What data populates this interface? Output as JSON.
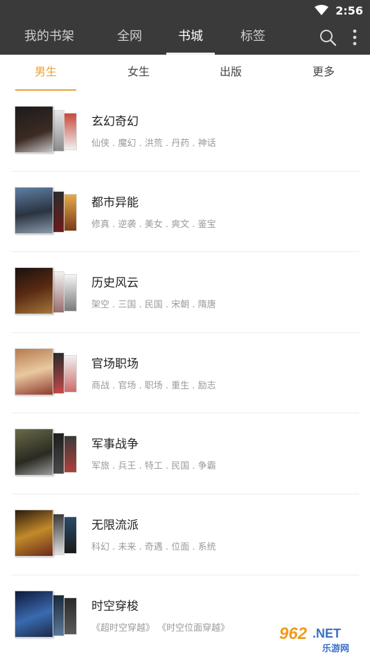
{
  "status_bar": {
    "time": "2:56",
    "wifi_icon": "wifi-icon"
  },
  "top_tabs": [
    {
      "label": "我的书架",
      "active": false
    },
    {
      "label": "全网",
      "active": false
    },
    {
      "label": "书城",
      "active": true
    },
    {
      "label": "标签",
      "active": false
    }
  ],
  "toolbar": {
    "search_icon": "search-icon",
    "more_icon": "more-vertical-icon"
  },
  "sub_tabs": [
    {
      "label": "男生",
      "active": true
    },
    {
      "label": "女生",
      "active": false
    },
    {
      "label": "出版",
      "active": false
    },
    {
      "label": "更多",
      "active": false
    }
  ],
  "categories": [
    {
      "title": "玄幻奇幻",
      "tags": "仙侠 . 魔幻 . 洪荒 . 丹药 . 神话"
    },
    {
      "title": "都市异能",
      "tags": "修真 . 逆袭 . 美女 . 爽文 . 鉴宝"
    },
    {
      "title": "历史风云",
      "tags": "架空 . 三国 . 民国 . 宋朝 . 隋唐"
    },
    {
      "title": "官场职场",
      "tags": "商战 . 官场 . 职场 . 重生 . 励志"
    },
    {
      "title": "军事战争",
      "tags": "军旅 . 兵王 . 特工 . 民国 . 争霸"
    },
    {
      "title": "无限流派",
      "tags": "科幻 . 未来 . 奇遇 . 位面 . 系统"
    },
    {
      "title": "时空穿梭",
      "tags": "《超时空穿越》 《时空位面穿越》"
    }
  ],
  "watermark": {
    "brand": "962.NET",
    "sub": "乐游网"
  },
  "colors": {
    "accent": "#e8a13a",
    "header_bg": "#3a3a3a"
  }
}
